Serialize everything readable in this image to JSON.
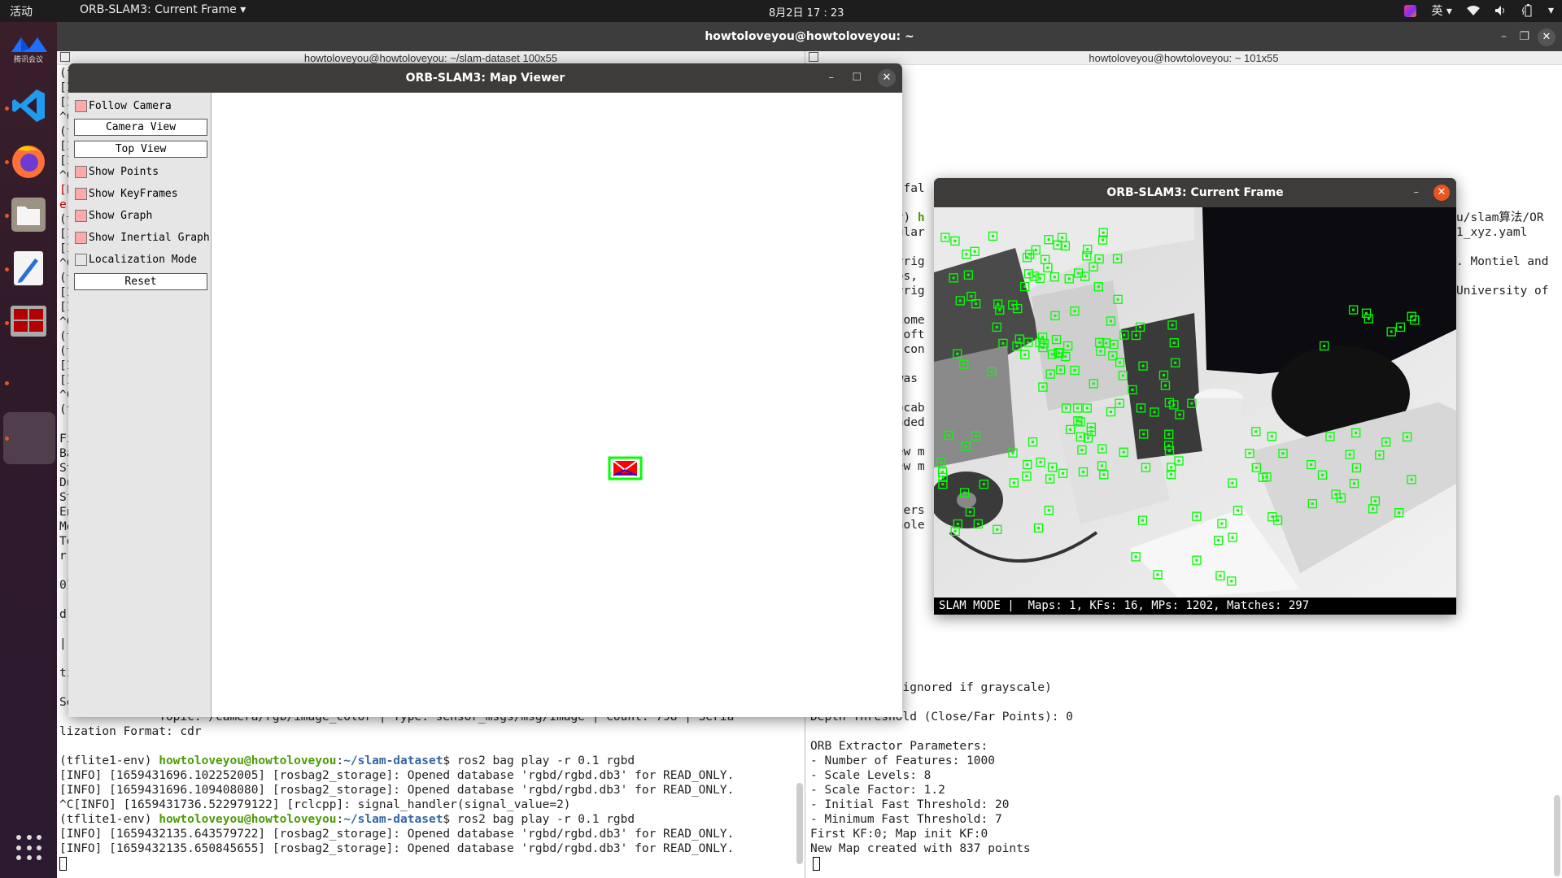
{
  "topbar": {
    "activities": "活动",
    "app_menu": "ORB-SLAM3: Current Frame ▾",
    "clock": "8月2日  17 : 23",
    "input_method": "英 ▾",
    "icons": [
      "jetbrains-toolbox-icon",
      "wifi-icon",
      "volume-icon",
      "battery-icon",
      "system-menu-chevron-icon"
    ]
  },
  "dock": {
    "items": [
      {
        "name": "tencent-meeting",
        "label": "腾讯会议"
      },
      {
        "name": "vscode"
      },
      {
        "name": "firefox"
      },
      {
        "name": "files"
      },
      {
        "name": "text-editor"
      },
      {
        "name": "terminator"
      },
      {
        "name": "running-app"
      },
      {
        "name": "active-app"
      }
    ],
    "show_apps": "show-applications"
  },
  "terminal_window": {
    "title": "howtoloveyou@howtoloveyou: ~",
    "left_pane": {
      "header": "howtoloveyou@howtoloveyou: ~/slam-dataset 100x55",
      "hidden_prefix_lines": [
        "(t",
        "[I",
        "[I",
        "^C",
        "(t",
        "[I",
        "[I",
        "^C",
        "[E",
        "e",
        "(t",
        "[I",
        "[I",
        "^C",
        "(t",
        "[I",
        "[I",
        "^C",
        "(t",
        "(t",
        "[I",
        "[I",
        "^C",
        "(t",
        "",
        "Fi",
        "Ba",
        "St",
        "Du",
        "St",
        "En",
        "Me",
        "To",
        "r",
        "",
        "01",
        "",
        "dr",
        "",
        "|",
        "",
        "ti",
        "",
        "Se"
      ],
      "lines": [
        {
          "type": "plain",
          "text": "              Topic: /camera/rgb/image_color | Type: sensor_msgs/msg/Image | Count: 798 | Seria"
        },
        {
          "type": "plain",
          "text": "lization Format: cdr"
        },
        {
          "type": "plain",
          "text": ""
        },
        {
          "type": "prompt",
          "env": "(tflite1-env) ",
          "user": "howtoloveyou@howtoloveyou",
          "path": "~/slam-dataset",
          "cmd": "$ ros2 bag play -r 0.1 rgbd"
        },
        {
          "type": "plain",
          "text": "[INFO] [1659431696.102252005] [rosbag2_storage]: Opened database 'rgbd/rgbd.db3' for READ_ONLY."
        },
        {
          "type": "plain",
          "text": "[INFO] [1659431696.109408080] [rosbag2_storage]: Opened database 'rgbd/rgbd.db3' for READ_ONLY."
        },
        {
          "type": "plain",
          "text": "^C[INFO] [1659431736.522979122] [rclcpp]: signal_handler(signal_value=2)"
        },
        {
          "type": "prompt",
          "env": "(tflite1-env) ",
          "user": "howtoloveyou@howtoloveyou",
          "path": "~/slam-dataset",
          "cmd": "$ ros2 bag play -r 0.1 rgbd"
        },
        {
          "type": "plain",
          "text": "[INFO] [1659432135.643579722] [rosbag2_storage]: Opened database 'rgbd/rgbd.db3' for READ_ONLY."
        },
        {
          "type": "plain",
          "text": "[INFO] [1659432135.650845655] [rosbag2_storage]: Opened database 'rgbd/rgbd.db3' for READ_ONLY."
        }
      ]
    },
    "right_pane": {
      "header": "howtoloveyou@howtoloveyou: ~ 101x55",
      "partial_lines": [
        {
          "row": 4,
          "text": ")"
        },
        {
          "row": 5,
          "text": ")"
        },
        {
          "row": 8,
          "text": ": fal"
        },
        {
          "row": 10,
          "text": "nv) h",
          "green_from": 4
        },
        {
          "row": 11,
          "text": "pular"
        },
        {
          "row": 13,
          "text": "pyrig"
        },
        {
          "row": 14,
          "text": "dós,"
        },
        {
          "row": 15,
          "text": "pyrig"
        },
        {
          "row": 17,
          "text": " come"
        },
        {
          "row": 18,
          "text": " soft"
        },
        {
          "row": 19,
          "text": "n con"
        },
        {
          "row": 21,
          "text": " was"
        },
        {
          "row": 23,
          "text": "Vocab"
        },
        {
          "row": 24,
          "text": "oaded"
        },
        {
          "row": 26,
          "text": "new m"
        },
        {
          "row": 27,
          "text": "new m"
        },
        {
          "row": 30,
          "text": "eters"
        },
        {
          "row": 31,
          "text": "nhole"
        }
      ],
      "right_partial_lines": [
        {
          "row": 10,
          "text": "u/slam算法/OR"
        },
        {
          "row": 11,
          "text": "1_xyz.yaml"
        },
        {
          "row": 13,
          "text": ". Montiel and"
        },
        {
          "row": 15,
          "text": "University of"
        }
      ],
      "lines": [
        "     r: RGB (ignored if grayscale)",
        "",
        "Depth Threshold (Close/Far Points): 0",
        "",
        "ORB Extractor Parameters:",
        "- Number of Features: 1000",
        "- Scale Levels: 8",
        "- Scale Factor: 1.2",
        "- Initial Fast Threshold: 20",
        "- Minimum Fast Threshold: 7",
        "First KF:0; Map init KF:0",
        "New Map created with 837 points"
      ]
    }
  },
  "map_viewer": {
    "title": "ORB-SLAM3: Map Viewer",
    "controls": {
      "follow_camera": {
        "label": "Follow Camera",
        "checked": true
      },
      "camera_view": "Camera View",
      "top_view": "Top View",
      "show_points": {
        "label": "Show Points",
        "checked": true
      },
      "show_keyframes": {
        "label": "Show KeyFrames",
        "checked": true
      },
      "show_graph": {
        "label": "Show Graph",
        "checked": true
      },
      "show_inertial_graph": {
        "label": "Show Inertial Graph",
        "checked": true
      },
      "localization_mode": {
        "label": "Localization Mode",
        "checked": false
      },
      "reset": "Reset"
    },
    "colors": {
      "checkbox_on": "#ffaaaa",
      "current_camera": "#00ff00",
      "keyframe": "#ff0000",
      "graph": "#0000ff"
    }
  },
  "current_frame": {
    "title": "ORB-SLAM3: Current Frame",
    "status": {
      "mode": "SLAM MODE",
      "text": "SLAM MODE |  Maps: 1, KFs: 16, MPs: 1202, Matches: 297",
      "maps": 1,
      "kfs": 16,
      "mps": 1202,
      "matches": 297
    },
    "keypoint_color": "#00ff00"
  }
}
